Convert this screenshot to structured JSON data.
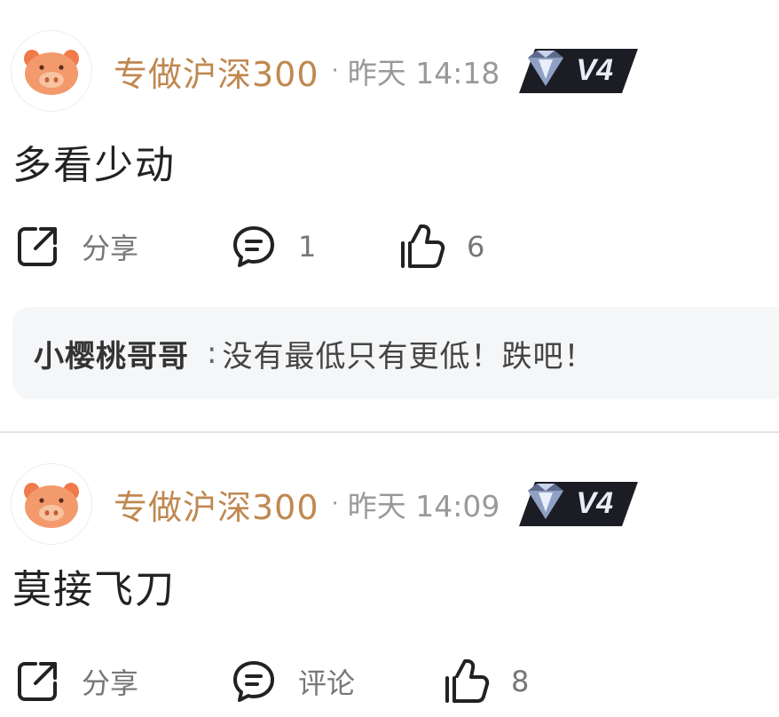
{
  "posts": [
    {
      "author": "专做沪深300",
      "separator": "·",
      "time": "昨天 14:18",
      "level": "V4",
      "text": "多看少动",
      "actions": {
        "share_label": "分享",
        "comment_label": "1",
        "like_label": "6"
      },
      "reply": {
        "user": "小樱桃哥哥",
        "separator": ":",
        "text": "没有最低只有更低！跌吧！"
      }
    },
    {
      "author": "专做沪深300",
      "separator": "·",
      "time": "昨天 14:09",
      "level": "V4",
      "text": "莫接飞刀",
      "actions": {
        "share_label": "分享",
        "comment_label": "评论",
        "like_label": "8"
      }
    }
  ],
  "colors": {
    "author": "#c08850",
    "meta": "#999999",
    "badge_bg": "#1c1d24",
    "reply_bg": "#f5f6f8"
  },
  "icons": {
    "avatar": "pig-avatar-icon",
    "badge": "diamond-icon",
    "share": "share-icon",
    "comment": "comment-icon",
    "like": "thumbs-up-icon"
  }
}
